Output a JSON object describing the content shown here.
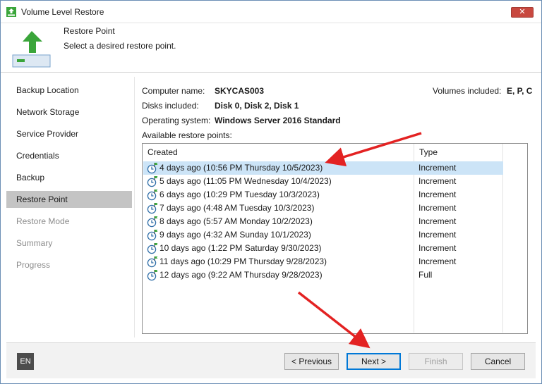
{
  "window": {
    "title": "Volume Level Restore",
    "close_label": "✕"
  },
  "header": {
    "title": "Restore Point",
    "subtitle": "Select a desired restore point."
  },
  "sidebar": {
    "items": [
      {
        "label": "Backup Location",
        "state": "normal"
      },
      {
        "label": "Network Storage",
        "state": "normal"
      },
      {
        "label": "Service Provider",
        "state": "normal"
      },
      {
        "label": "Credentials",
        "state": "normal"
      },
      {
        "label": "Backup",
        "state": "normal"
      },
      {
        "label": "Restore Point",
        "state": "active"
      },
      {
        "label": "Restore Mode",
        "state": "disabled"
      },
      {
        "label": "Summary",
        "state": "disabled"
      },
      {
        "label": "Progress",
        "state": "disabled"
      }
    ]
  },
  "info": {
    "computer_name_label": "Computer name:",
    "computer_name": "SKYCAS003",
    "volumes_label": "Volumes included:",
    "volumes": "E, P, C",
    "disks_label": "Disks included:",
    "disks": "Disk 0, Disk 2, Disk 1",
    "os_label": "Operating system:",
    "os": "Windows Server 2016 Standard",
    "available_label": "Available restore points:"
  },
  "table": {
    "headers": {
      "created": "Created",
      "type": "Type"
    },
    "rows": [
      {
        "created": "4 days ago (10:56 PM Thursday 10/5/2023)",
        "type": "Increment",
        "selected": true
      },
      {
        "created": "5 days ago (11:05 PM Wednesday 10/4/2023)",
        "type": "Increment"
      },
      {
        "created": "6 days ago (10:29 PM Tuesday 10/3/2023)",
        "type": "Increment"
      },
      {
        "created": "7 days ago (4:48 AM Tuesday 10/3/2023)",
        "type": "Increment"
      },
      {
        "created": "8 days ago (5:57 AM Monday 10/2/2023)",
        "type": "Increment"
      },
      {
        "created": "9 days ago (4:32 AM Sunday 10/1/2023)",
        "type": "Increment"
      },
      {
        "created": "10 days ago (1:22 PM Saturday 9/30/2023)",
        "type": "Increment"
      },
      {
        "created": "11 days ago (10:29 PM Thursday 9/28/2023)",
        "type": "Increment"
      },
      {
        "created": "12 days ago (9:22 AM Thursday 9/28/2023)",
        "type": "Full"
      }
    ]
  },
  "footer": {
    "language": "EN",
    "previous": "< Previous",
    "next": "Next >",
    "finish": "Finish",
    "cancel": "Cancel"
  },
  "colors": {
    "accent": "#0078d7",
    "selected_row": "#cce4f7",
    "active_step": "#c4c4c4",
    "arrow": "#e32222",
    "icon_green": "#3aa53a"
  },
  "icons": {
    "app": "restore-app-icon",
    "header": "upload-arrow-icon",
    "restore_point": "clock-flag-icon"
  }
}
